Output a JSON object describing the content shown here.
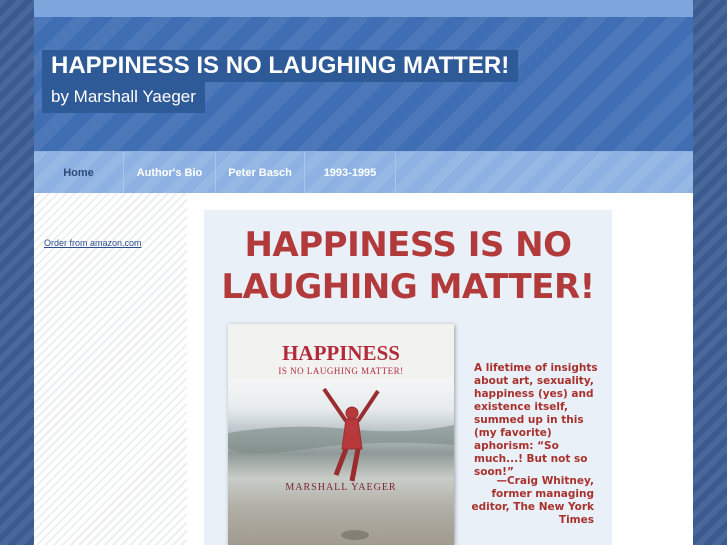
{
  "header": {
    "title": "HAPPINESS IS NO LAUGHING MATTER!",
    "subtitle": "by Marshall Yaeger"
  },
  "nav": {
    "items": [
      {
        "label": "Home",
        "active": true
      },
      {
        "label": "Author's Bio",
        "active": false
      },
      {
        "label": "Peter Basch",
        "active": false
      },
      {
        "label": "1993-1995",
        "active": false
      }
    ]
  },
  "sidebar": {
    "link": "Order from amazon.com"
  },
  "promo": {
    "heading_line1": "HAPPINESS IS NO",
    "heading_line2": "LAUGHING MATTER!",
    "book_title": "HAPPINESS",
    "book_subtitle": "IS NO LAUGHING MATTER!",
    "book_author": "MARSHALL YAEGER",
    "quote": "A lifetime of insights about art, sexuality, happiness (yes) and existence itself, summed up in this (my favorite) aphorism: “So much...! But not so soon!”",
    "quote_attribution": "—Craig Whitney, former managing editor, The New York Times"
  },
  "colors": {
    "header_blue": "#3f6eb5",
    "nav_blue": "#8cb1e2",
    "promo_red": "#b23a3a"
  }
}
